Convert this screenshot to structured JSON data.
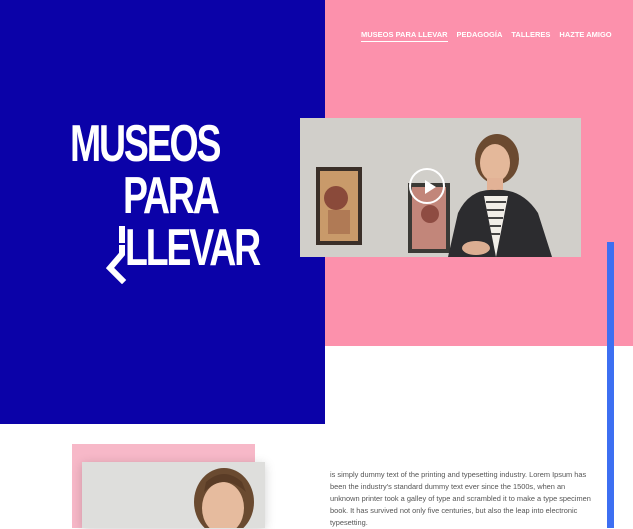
{
  "nav": {
    "items": [
      {
        "label": "MUSEOS PARA LLEVAR",
        "active": true
      },
      {
        "label": "PEDAGOGÍA",
        "active": false
      },
      {
        "label": "TALLERES",
        "active": false
      },
      {
        "label": "HAZTE AMIGO",
        "active": false
      }
    ]
  },
  "hero": {
    "logo_lines": [
      "MUSEOS",
      "PARA",
      "LLEVAR"
    ]
  },
  "content": {
    "paragraph": "is simply dummy text of the printing and typesetting industry. Lorem Ipsum has been the industry's standard dummy text ever since the 1500s, when an unknown printer took a galley of type and scrambled it to make a type specimen book. It has survived not only five centuries, but also the leap into electronic typesetting."
  },
  "colors": {
    "blue_panel": "#0b02a8",
    "pink_panel": "#fc91ac",
    "accent_bar": "#3d6ff2"
  },
  "icons": {
    "play": "play-icon"
  }
}
